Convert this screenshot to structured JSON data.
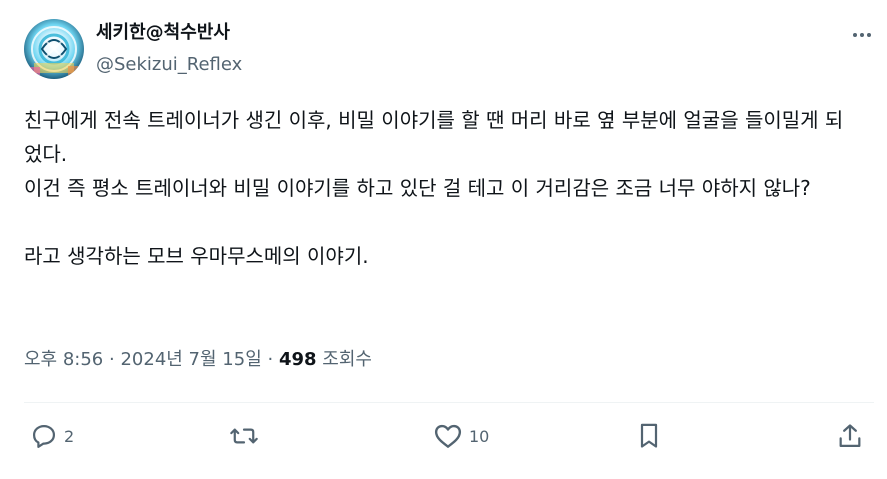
{
  "tweet": {
    "author_name": "세키한@척수반사",
    "author_handle": "@Sekizui_Reflex",
    "text": "친구에게 전속 트레이너가 생긴 이후, 비밀 이야기를 할 땐 머리 바로 옆 부분에 얼굴을 들이밀게 되었다.\n이건 즉 평소 트레이너와 비밀 이야기를 하고 있단 걸 테고 이 거리감은 조금 너무 야하지 않나?\n\n라고 생각하는 모브 우마무스메의 이야기.",
    "time": "오후 8:56",
    "separator": "·",
    "date": "2024년 7월 15일",
    "views_count": "498",
    "views_label": "조회수"
  },
  "actions": {
    "reply_count": "2",
    "retweet_count": "",
    "like_count": "10"
  },
  "icons": {
    "more": "more-dots-icon",
    "reply": "reply-icon",
    "retweet": "retweet-icon",
    "like": "heart-icon",
    "bookmark": "bookmark-icon",
    "share": "share-icon"
  },
  "colors": {
    "text": "#0f1419",
    "secondary": "#536471",
    "divider": "#eff3f4"
  }
}
